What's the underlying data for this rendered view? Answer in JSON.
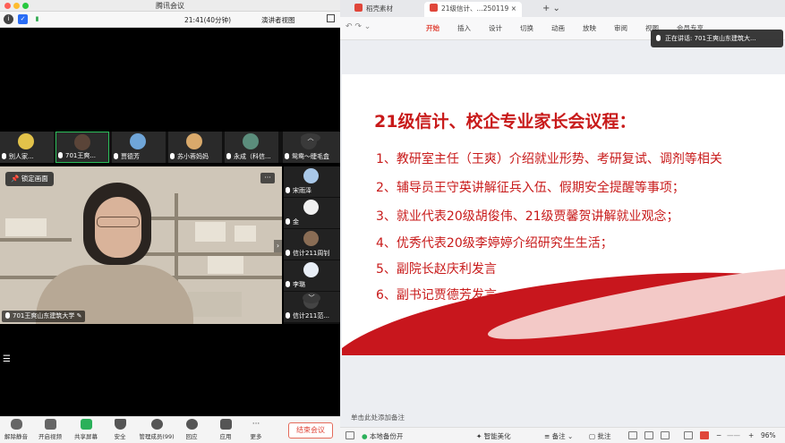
{
  "meeting": {
    "window_title": "腾讯会议",
    "toolbar": {
      "duration": "21:41(40分钟)",
      "view_mode": "演讲者视图"
    },
    "thumbnails": [
      {
        "name": "别人家..."
      },
      {
        "name": "701王爽..."
      },
      {
        "name": "贾德芳"
      },
      {
        "name": "苏小蓉妈妈"
      },
      {
        "name": "永成（科信..."
      },
      {
        "name": "鸳鸯～睫毛盒"
      }
    ],
    "main_video": {
      "lock_label": "锁定画面",
      "speaker_name": "701王爽山东建筑大学"
    },
    "side_participants": [
      {
        "name": "宋雨泽"
      },
      {
        "name": "金"
      },
      {
        "name": "信计211周钊"
      },
      {
        "name": "李璐"
      },
      {
        "name": "信计211范..."
      }
    ],
    "controls": [
      {
        "label": "解除静音"
      },
      {
        "label": "开启视频"
      },
      {
        "label": "共享屏幕"
      },
      {
        "label": "安全"
      },
      {
        "label": "管理成员(99)"
      },
      {
        "label": "回应"
      },
      {
        "label": "应用"
      },
      {
        "label": "更多"
      }
    ],
    "end_label": "结束会议"
  },
  "wps": {
    "tabs": [
      {
        "label": "稻壳素材"
      },
      {
        "label": "21级信计、...250119"
      }
    ],
    "ribbon": [
      "开始",
      "插入",
      "设计",
      "切换",
      "动画",
      "放映",
      "审阅",
      "视图",
      "会员专享"
    ],
    "speaking_label": "正在讲话: 701王爽山东建筑大...",
    "notes_placeholder": "单击此处添加备注",
    "status": {
      "backup": "本地备份开",
      "beautify": "智能美化",
      "notes": "备注",
      "comments": "批注",
      "zoom": "96%"
    }
  },
  "slide": {
    "title": "21级信计、校企专业家长会议程：",
    "items": [
      "1、教研室主任（王爽）介绍就业形势、考研复试、调剂等相关",
      "2、辅导员王守英讲解征兵入伍、假期安全提醒等事项；",
      "3、就业代表20级胡俊伟、21级贾馨贺讲解就业观念；",
      "4、优秀代表20级李婷婷介绍研究生生活；",
      "5、副院长赵庆利发言",
      "6、副书记贾德芳发言"
    ]
  },
  "colors": {
    "accent_red": "#c81a1a",
    "wps_tab_active": "#e0463a",
    "meeting_blue": "#2a6df5"
  }
}
